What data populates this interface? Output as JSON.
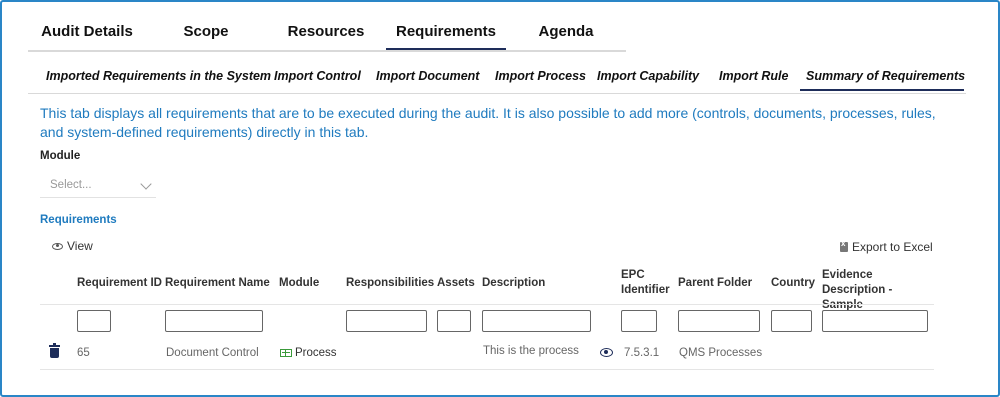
{
  "tabs": [
    {
      "label": "Audit Details",
      "active": false
    },
    {
      "label": "Scope",
      "active": false
    },
    {
      "label": "Resources",
      "active": false
    },
    {
      "label": "Requirements",
      "active": true
    },
    {
      "label": "Agenda",
      "active": false
    }
  ],
  "subtabs": [
    {
      "label": "Imported Requirements in the System",
      "active": false
    },
    {
      "label": "Import Control",
      "active": false
    },
    {
      "label": "Import Document",
      "active": false
    },
    {
      "label": "Import Process",
      "active": false
    },
    {
      "label": "Import Capability",
      "active": false
    },
    {
      "label": "Import Rule",
      "active": false
    },
    {
      "label": "Summary of Requirements",
      "active": true
    }
  ],
  "description": "This tab displays all requirements that are to be executed during the audit. It is also possible to add more (controls, documents, processes, rules, and system-defined requirements) directly in this tab.",
  "module": {
    "label": "Module",
    "placeholder": "Select..."
  },
  "requirements_title": "Requirements",
  "toolbar": {
    "view_label": "View",
    "export_label": "Export to Excel"
  },
  "table": {
    "columns": [
      {
        "key": "req_id",
        "label": "Requirement ID"
      },
      {
        "key": "req_name",
        "label": "Requirement Name"
      },
      {
        "key": "module",
        "label": "Module"
      },
      {
        "key": "responsibilities",
        "label": "Responsibilities"
      },
      {
        "key": "assets",
        "label": "Assets"
      },
      {
        "key": "description",
        "label": "Description"
      },
      {
        "key": "epc",
        "label": "EPC Identifier"
      },
      {
        "key": "parent_folder",
        "label": "Parent Folder"
      },
      {
        "key": "country",
        "label": "Country"
      },
      {
        "key": "evidence",
        "label": "Evidence Description - Sample"
      }
    ],
    "rows": [
      {
        "req_id": "65",
        "req_name": "Document Control",
        "module": "Process",
        "responsibilities": "",
        "assets": "",
        "description": "This is the process",
        "epc": "7.5.3.1",
        "parent_folder": "QMS Processes",
        "country": "",
        "evidence": ""
      }
    ]
  },
  "colors": {
    "accent": "#1f7bbf",
    "tab_underline": "#1e2d5a",
    "frame": "#2a86c7",
    "process": "#3a9a3a"
  }
}
